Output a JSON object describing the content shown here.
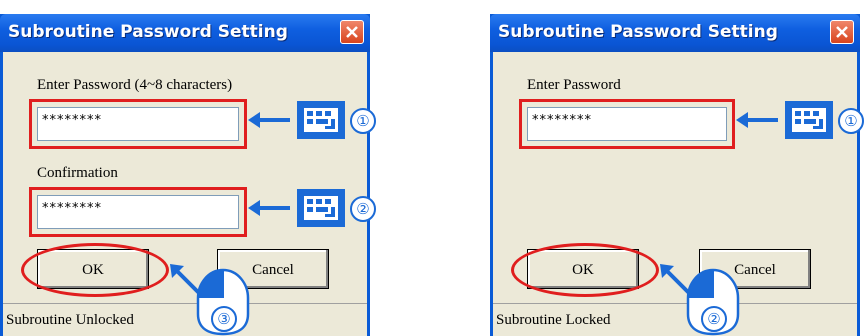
{
  "colors": {
    "title_bar": "#0a55d4",
    "highlight": "#e01e1e",
    "annotation_blue": "#1b6ad6",
    "dialog_bg": "#ece9d8"
  },
  "left_dialog": {
    "title": "Subroutine Password Setting",
    "password_label": "Enter Password (4~8 characters)",
    "password_value": "********",
    "confirm_label": "Confirmation",
    "confirm_value": "********",
    "ok_label": "OK",
    "cancel_label": "Cancel",
    "status": "Subroutine Unlocked",
    "steps": [
      "①",
      "②",
      "③"
    ]
  },
  "right_dialog": {
    "title": "Subroutine Password Setting",
    "password_label": "Enter Password",
    "password_value": "********",
    "ok_label": "OK",
    "cancel_label": "Cancel",
    "status": "Subroutine Locked",
    "steps": [
      "①",
      "②"
    ]
  },
  "icons": [
    "close-icon",
    "keyboard-icon",
    "arrow-left-icon",
    "mouse-icon"
  ]
}
